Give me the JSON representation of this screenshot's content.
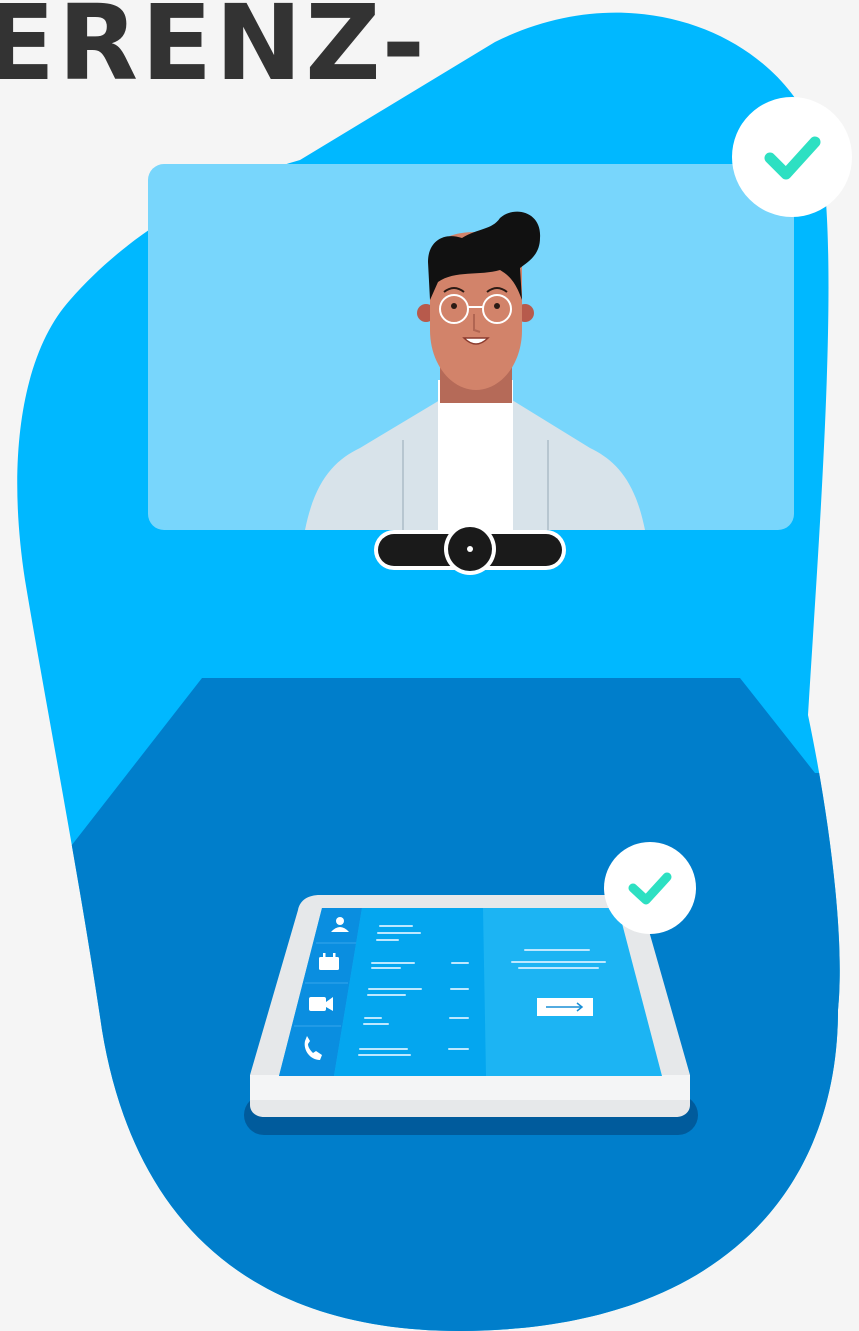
{
  "headline": {
    "text": "ERENZ-"
  },
  "colors": {
    "background": "#f5f5f5",
    "headline": "#333333",
    "blob_light": "#00b8ff",
    "blob_dark": "#007ecb",
    "screen": "#78d6fc",
    "check": "#2de0c2",
    "tablet_frame": "#e6e8ea",
    "tablet_panel": "#1cb4f3",
    "tablet_sidebar": "#0a8ee0",
    "skin": "#d2836a",
    "hair": "#111111",
    "jacket": "#d8e3ea",
    "camera_bar": "#1a1a1a"
  },
  "icons": {
    "screen_check": "checkmark-icon",
    "tablet_check": "checkmark-icon",
    "contact": "person-icon",
    "calendar": "calendar-icon",
    "video": "video-camera-icon",
    "phone": "phone-icon",
    "arrow": "arrow-right-icon"
  }
}
